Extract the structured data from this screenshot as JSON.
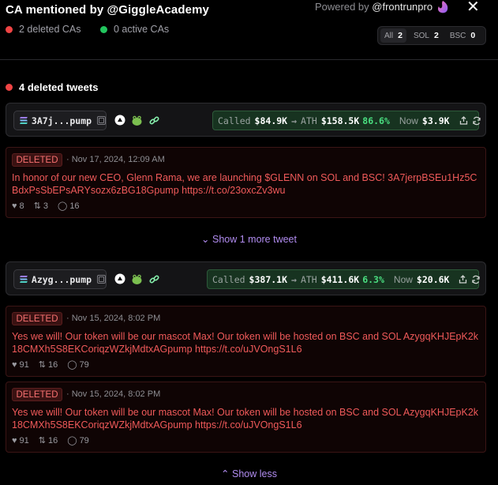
{
  "header": {
    "title": "CA mentioned by @GiggleAcademy",
    "powered_prefix": "Powered by",
    "powered_handle": "@frontrunpro",
    "close_label": "✕",
    "deleted_cas": "2 deleted CAs",
    "active_cas": "0 active CAs"
  },
  "filters": [
    {
      "label": "All",
      "count": "2"
    },
    {
      "label": "SOL",
      "count": "2"
    },
    {
      "label": "BSC",
      "count": "0"
    }
  ],
  "section": {
    "title": "4 deleted tweets"
  },
  "tokens": [
    {
      "ca": "3A7j...pump",
      "called_label": "Called",
      "called": "$84.9K",
      "ath_label": "ATH",
      "ath": "$158.5K",
      "ath_pct": "86.6%",
      "now_label": "Now",
      "now": "$3.9K",
      "tweets": [
        {
          "badge": "DELETED",
          "date": "· Nov 17, 2024, 12:09 AM",
          "text": "In honor of our new CEO, Glenn Rama, we are launching $GLENN on SOL and BSC! 3A7jerpBSEu1Hz5CBdxPsSbEPsARYsozx6zBG18Gpump https://t.co/23oxcZv3wu",
          "likes": "8",
          "retweets": "3",
          "replies": "16"
        }
      ],
      "show_more": "Show 1 more tweet"
    },
    {
      "ca": "Azyg...pump",
      "called_label": "Called",
      "called": "$387.1K",
      "ath_label": "ATH",
      "ath": "$411.6K",
      "ath_pct": "6.3%",
      "now_label": "Now",
      "now": "$20.6K",
      "tweets": [
        {
          "badge": "DELETED",
          "date": "· Nov 15, 2024, 8:02 PM",
          "text": "Yes we will! Our token will be our mascot Max! Our token will be hosted on BSC and SOL AzygqKHJEpK2k18CMXh5S8EKCoriqzWZkjMdtxAGpump https://t.co/uJVOngS1L6",
          "likes": "91",
          "retweets": "16",
          "replies": "79"
        },
        {
          "badge": "DELETED",
          "date": "· Nov 15, 2024, 8:02 PM",
          "text": "Yes we will! Our token will be our mascot Max! Our token will be hosted on BSC and SOL AzygqKHJEpK2k18CMXh5S8EKCoriqzWZkjMdtxAGpump https://t.co/uJVOngS1L6",
          "likes": "91",
          "retweets": "16",
          "replies": "79"
        }
      ],
      "show_more": "Show less"
    }
  ],
  "icons": {
    "copy": "copy-icon",
    "coin": "coin-icon",
    "frog": "frog-icon",
    "link": "link-icon",
    "share": "share-icon",
    "refresh": "refresh-icon",
    "heart": "heart-icon",
    "retweet": "retweet-icon",
    "reply": "reply-icon"
  },
  "colors": {
    "deleted_dot": "#ef4444",
    "active_dot": "#22c55e",
    "deleted_text": "#f05a5a",
    "gain": "#4ade80",
    "link_purple": "#b18cf0"
  }
}
